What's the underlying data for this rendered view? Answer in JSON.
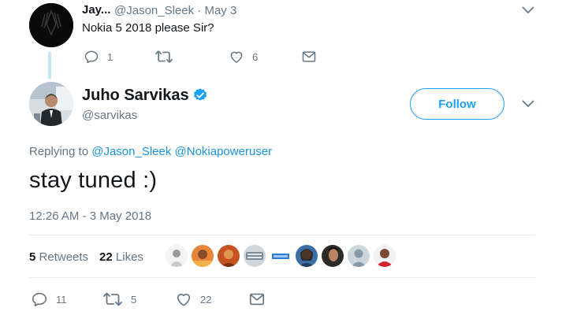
{
  "parent": {
    "name": "Jay...",
    "handle_time": "@Jason_Sleek · May 3",
    "text": "Nokia 5 2018 please Sir?",
    "replies": "1",
    "retweets": "",
    "likes": "6"
  },
  "tweet": {
    "name": "Juho Sarvikas",
    "handle": "@sarvikas",
    "follow_label": "Follow",
    "replying_prefix": "Replying to",
    "mention_1": "@Jason_Sleek",
    "mention_2": "@Nokiapoweruser",
    "text": "stay tuned :)",
    "timestamp": "12:26 AM - 3 May 2018",
    "retweet_count": "5",
    "retweet_label": "Retweets",
    "like_count": "22",
    "like_label": "Likes",
    "footer_replies": "11",
    "footer_retweets": "5",
    "footer_likes": "22"
  },
  "colors": {
    "accent": "#1da1f2",
    "link": "#1b95e0",
    "secondary_text": "#657786",
    "verified": "#1da1f2"
  },
  "icons": [
    "reply-icon",
    "retweet-icon",
    "heart-icon",
    "envelope-icon",
    "chevron-down-icon",
    "verified-badge-icon"
  ]
}
